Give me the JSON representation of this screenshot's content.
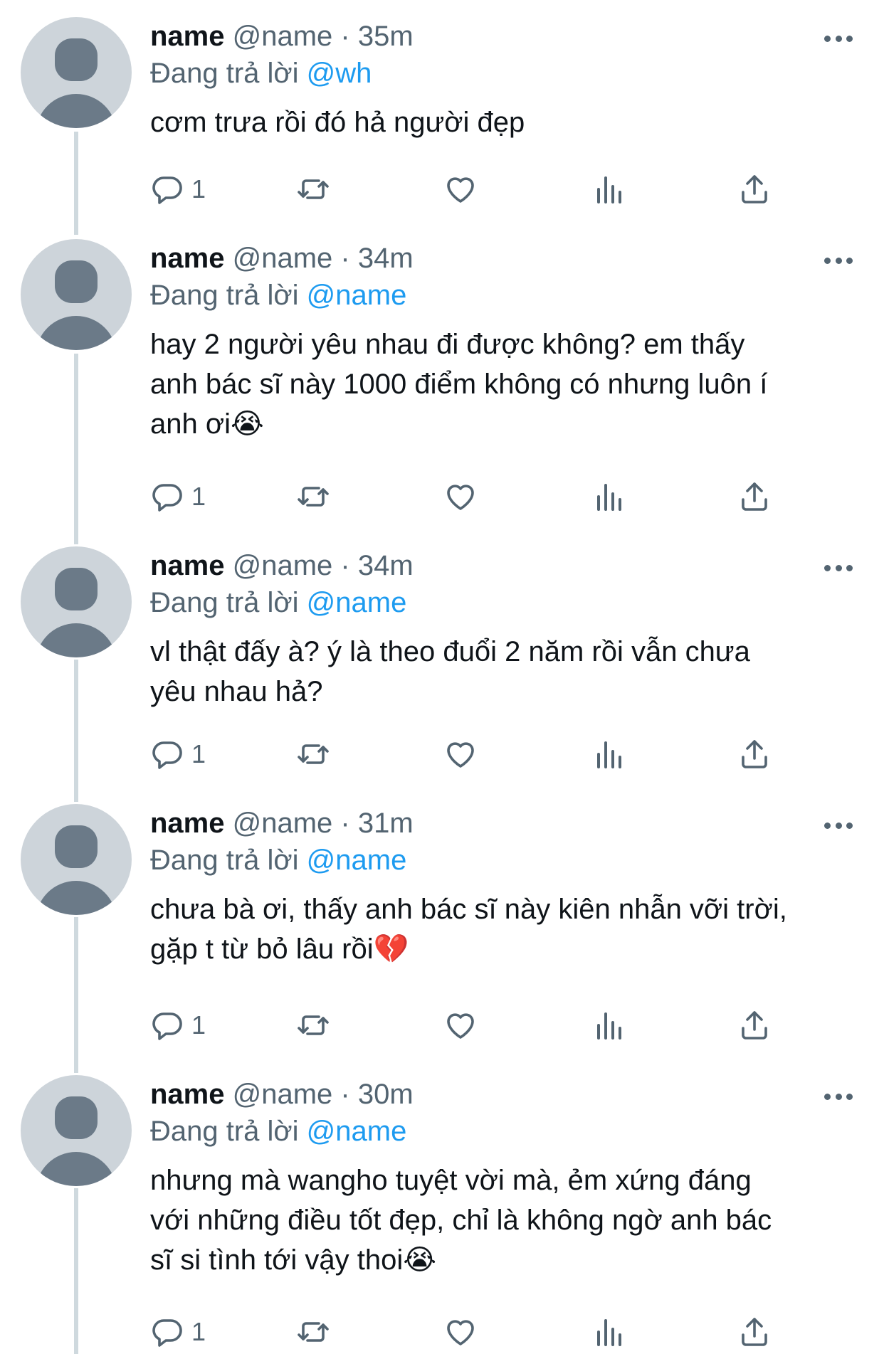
{
  "labels": {
    "replying_to": "Đang trả lời",
    "separator": "·"
  },
  "icons": {
    "reply": "reply-icon",
    "retweet": "retweet-icon",
    "like": "like-icon",
    "views": "views-icon",
    "share": "share-icon",
    "more": "more-icon"
  },
  "colors": {
    "mention": "#1d9bf0",
    "secondary_text": "#536471",
    "avatar_bg": "#cdd4da",
    "avatar_fg": "#6b7a88",
    "thread_line": "#cfd9de"
  },
  "tweets": [
    {
      "name": "name",
      "handle": "@name",
      "time": "35m",
      "reply_to": "@wh",
      "text": "cơm trưa rồi đó hả người đẹp",
      "reply_count": "1"
    },
    {
      "name": "name",
      "handle": "@name",
      "time": "34m",
      "reply_to": "@name",
      "text": "hay 2 người yêu nhau đi được không? em thấy\nanh bác sĩ này 1000 điểm không có nhưng luôn í\nanh ơi😭",
      "reply_count": "1"
    },
    {
      "name": "name",
      "handle": "@name",
      "time": "34m",
      "reply_to": "@name",
      "text": "vl thật đấy à? ý là theo đuổi 2 năm rồi vẫn chưa\nyêu nhau hả?",
      "reply_count": "1"
    },
    {
      "name": "name",
      "handle": "@name",
      "time": "31m",
      "reply_to": "@name",
      "text": "chưa bà ơi, thấy anh bác sĩ này kiên nhẫn vỡi trời,\ngặp t từ bỏ lâu rồi💔",
      "reply_count": "1"
    },
    {
      "name": "name",
      "handle": "@name",
      "time": "30m",
      "reply_to": "@name",
      "text": "nhưng mà wangho tuyệt vời mà, ẻm xứng đáng\nvới những điều tốt đẹp, chỉ là không ngờ anh bác\nsĩ si tình tới vậy thoi😭",
      "reply_count": "1"
    }
  ]
}
